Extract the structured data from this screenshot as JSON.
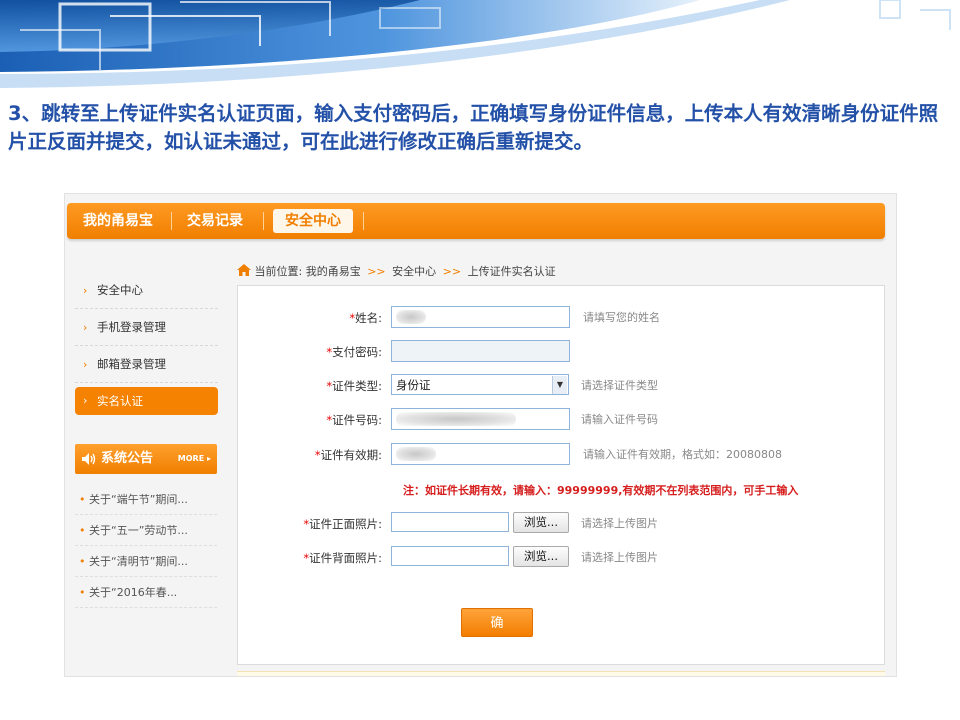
{
  "instruction": "3、跳转至上传证件实名认证页面，输入支付密码后，正确填写身份证件信息，上传本人有效清晰身份证件照片正反面并提交，如认证未通过，可在此进行修改正确后重新提交。",
  "topnav": {
    "tabs": [
      "我的甬易宝",
      "交易记录",
      "安全中心"
    ],
    "active": "安全中心"
  },
  "breadcrumb": {
    "prefix": "当前位置:",
    "items": [
      "我的甬易宝",
      "安全中心",
      "上传证件实名认证"
    ],
    "separator": ">>"
  },
  "sidebar": {
    "items": [
      "安全中心",
      "手机登录管理",
      "邮箱登录管理",
      "实名认证"
    ],
    "active": "实名认证",
    "notice_title": "系统公告",
    "notice_more": "MORE",
    "news": [
      "关于“端午节”期间...",
      "关于“五一”劳动节...",
      "关于“清明节”期间...",
      "关于“2016年春..."
    ]
  },
  "form": {
    "name": {
      "label": "姓名:",
      "hint": "请填写您的姓名"
    },
    "pay_password": {
      "label": "支付密码:"
    },
    "cert_type": {
      "label": "证件类型:",
      "value": "身份证",
      "hint": "请选择证件类型"
    },
    "cert_number": {
      "label": "证件号码:",
      "hint": "请输入证件号码"
    },
    "validity": {
      "label": "证件有效期:",
      "hint": "请输入证件有效期，格式如：20080808"
    },
    "note": "注：如证件长期有效，请输入：99999999,有效期不在列表范围内，可手工输入",
    "front_photo": {
      "label": "证件正面照片:",
      "browse": "浏览...",
      "hint": "请选择上传图片"
    },
    "back_photo": {
      "label": "证件背面照片:",
      "browse": "浏览...",
      "hint": "请选择上传图片"
    },
    "required_mark": "*",
    "submit": "确 定"
  },
  "colors": {
    "accent": "#f58200",
    "title_text": "#2451a8",
    "note_red": "#d61e1e",
    "input_border": "#8fb3d9"
  }
}
